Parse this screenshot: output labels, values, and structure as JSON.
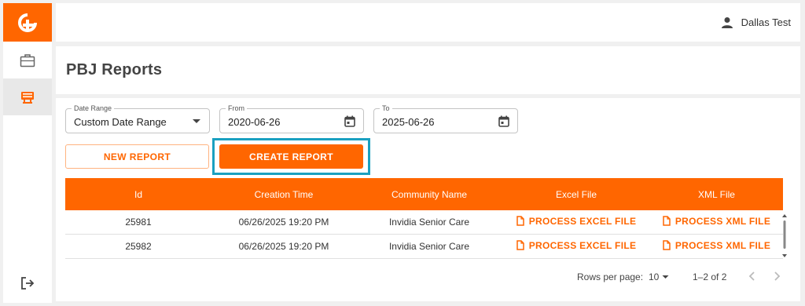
{
  "user": {
    "name": "Dallas Test"
  },
  "page": {
    "title": "PBJ Reports"
  },
  "filters": {
    "date_range": {
      "label": "Date Range",
      "value": "Custom Date Range"
    },
    "from": {
      "label": "From",
      "value": "2020-06-26"
    },
    "to": {
      "label": "To",
      "value": "2025-06-26"
    }
  },
  "buttons": {
    "new_report": "NEW REPORT",
    "create_report": "CREATE REPORT"
  },
  "table": {
    "columns": [
      "Id",
      "Creation Time",
      "Community Name",
      "Excel File",
      "XML File"
    ],
    "rows": [
      {
        "id": "25981",
        "creation_time": "06/26/2025 19:20 PM",
        "community": "Invidia Senior Care",
        "excel": "PROCESS EXCEL FILE",
        "xml": "PROCESS XML FILE"
      },
      {
        "id": "25982",
        "creation_time": "06/26/2025 19:20 PM",
        "community": "Invidia Senior Care",
        "excel": "PROCESS EXCEL FILE",
        "xml": "PROCESS XML FILE"
      }
    ]
  },
  "pagination": {
    "rows_per_page_label": "Rows per page:",
    "rows_per_page": "10",
    "range": "1–2 of 2"
  },
  "colors": {
    "accent": "#ff6600",
    "highlight": "#1aa0c0"
  },
  "icons": {
    "logo": "plus-logo-icon",
    "nav": [
      "briefcase-icon",
      "reports-icon"
    ],
    "logout": "logout-icon",
    "user": "person-icon",
    "calendar": "calendar-icon",
    "file": "file-icon"
  }
}
